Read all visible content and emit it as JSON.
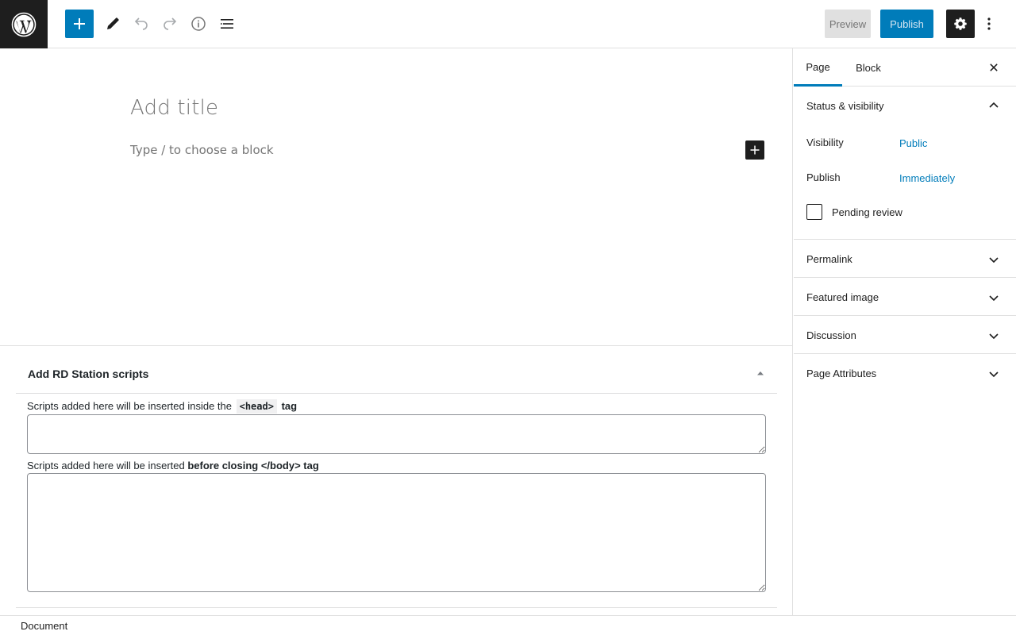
{
  "header": {
    "preview_label": "Preview",
    "publish_label": "Publish",
    "icons": [
      "wordpress-icon",
      "plus-icon",
      "pencil-icon",
      "undo-icon",
      "redo-icon",
      "info-icon",
      "list-view-icon",
      "gear-icon",
      "more-vertical-icon"
    ]
  },
  "canvas": {
    "title_placeholder": "Add title",
    "block_placeholder": "Type / to choose a block"
  },
  "metabox": {
    "title": "Add RD Station scripts",
    "head_label_prefix": "Scripts added here will be inserted inside the",
    "head_label_code": "<head>",
    "head_label_suffix": "tag",
    "body_label_prefix": "Scripts added here will be inserted",
    "body_label_bold": "before closing </body> tag",
    "head_value": "",
    "body_value": ""
  },
  "footer": {
    "breadcrumb": "Document"
  },
  "sidebar": {
    "tabs": [
      {
        "label": "Page",
        "active": true
      },
      {
        "label": "Block",
        "active": false
      }
    ],
    "status_panel": {
      "title": "Status & visibility",
      "visibility_label": "Visibility",
      "visibility_value": "Public",
      "publish_label": "Publish",
      "publish_value": "Immediately",
      "pending_label": "Pending review",
      "pending_checked": false
    },
    "panels": [
      {
        "title": "Permalink"
      },
      {
        "title": "Featured image"
      },
      {
        "title": "Discussion"
      },
      {
        "title": "Page Attributes"
      }
    ]
  },
  "colors": {
    "accent": "#007cba",
    "dark": "#1e1e1e",
    "border": "#e0e0e0"
  }
}
